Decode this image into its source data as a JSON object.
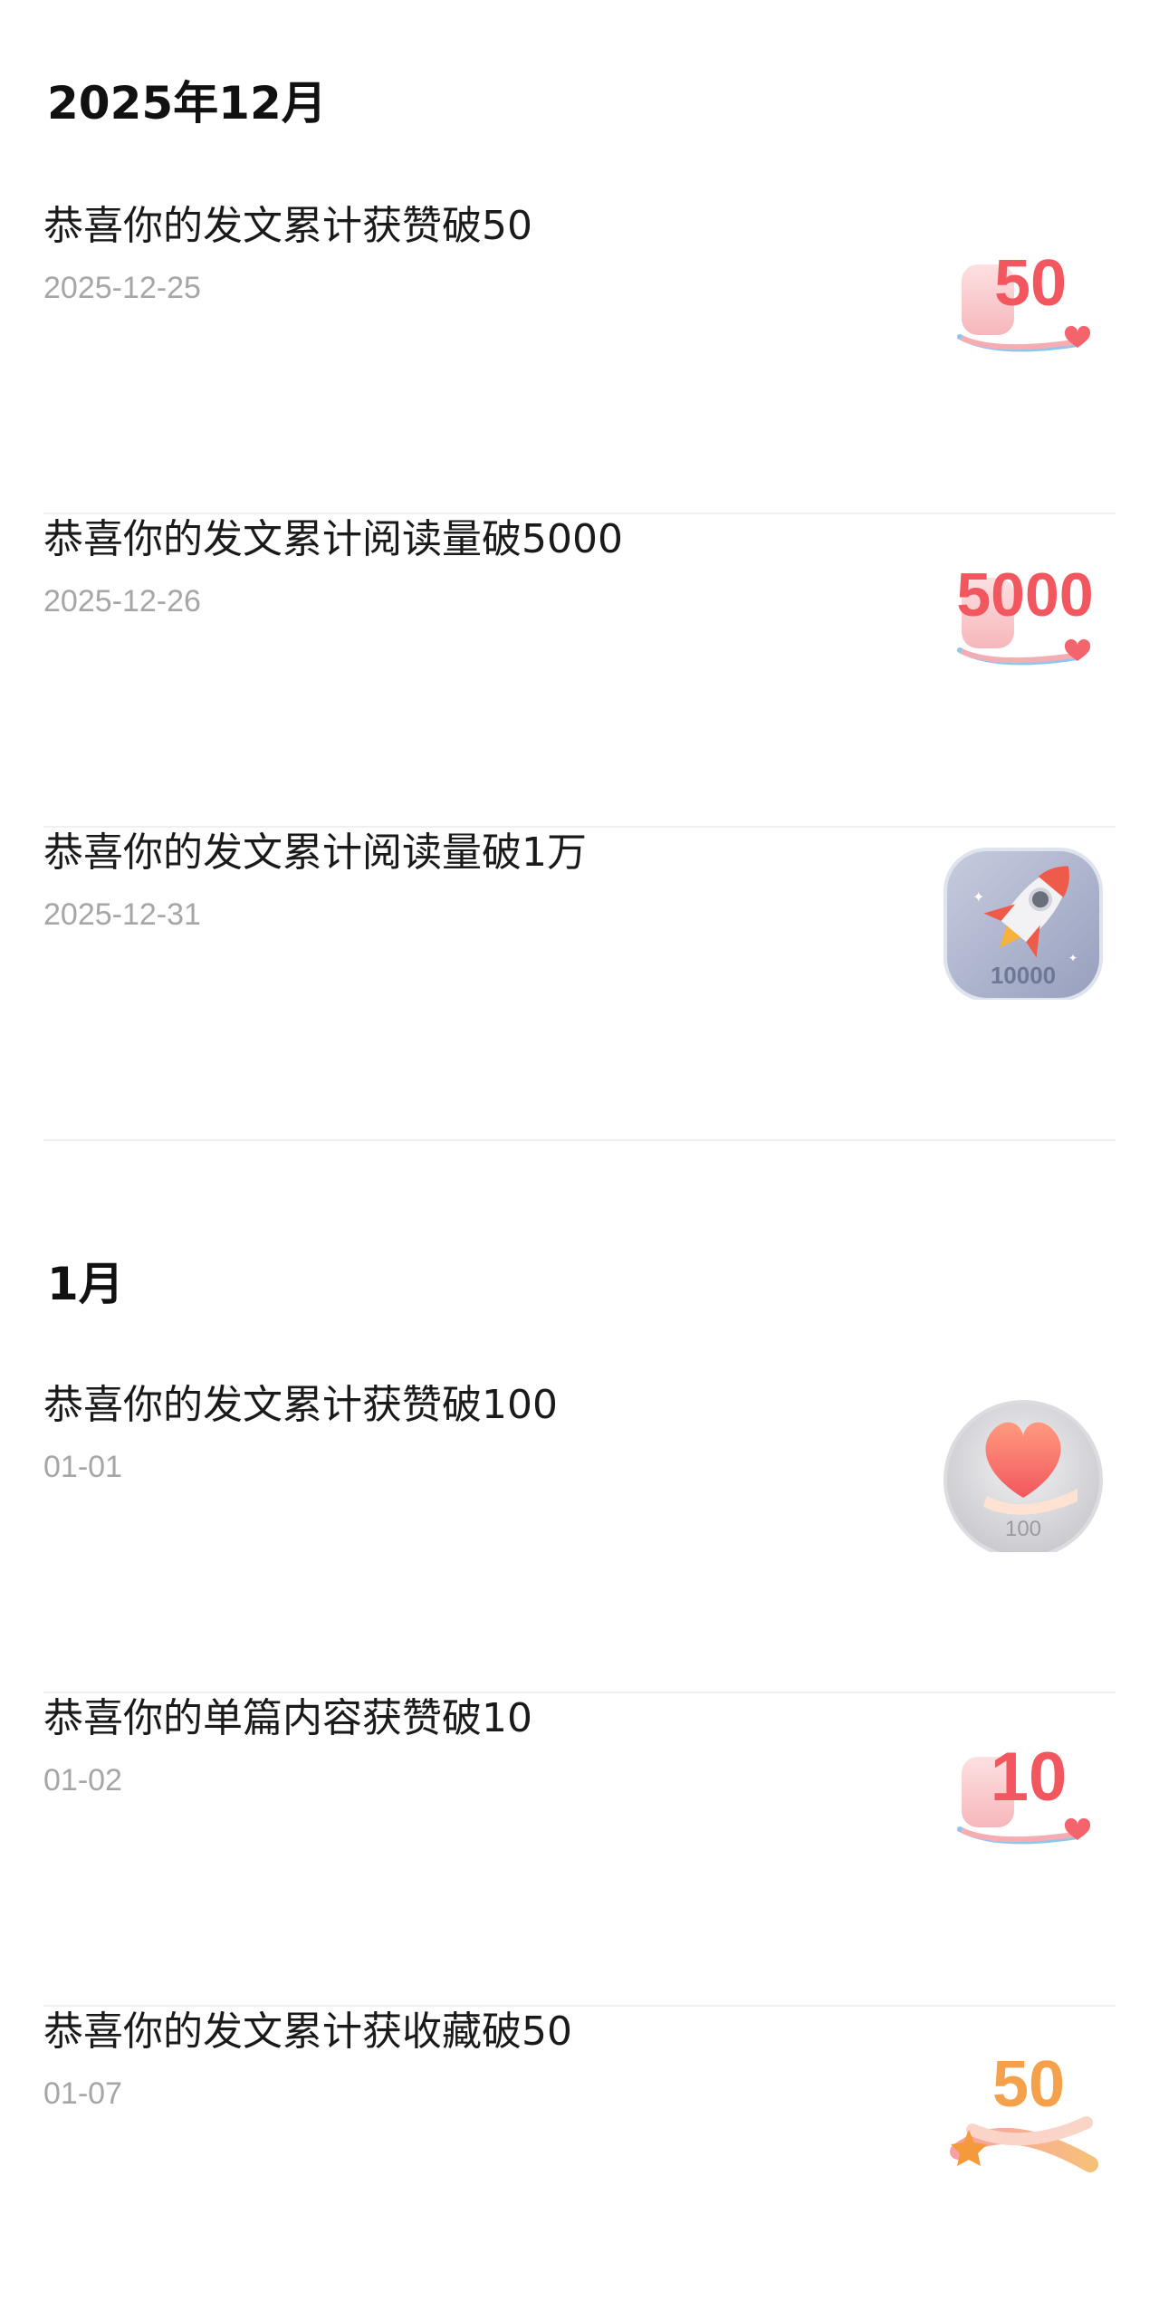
{
  "sections": [
    {
      "title": "2025年12月",
      "items": [
        {
          "title": "恭喜你的发文累计获赞破50",
          "date": "2025-12-25",
          "badge": {
            "icon": "likes-milestone-icon",
            "number": "50"
          }
        },
        {
          "title": "恭喜你的发文累计阅读量破5000",
          "date": "2025-12-26",
          "badge": {
            "icon": "reads-milestone-icon",
            "number": "5000"
          }
        },
        {
          "title": "恭喜你的发文累计阅读量破1万",
          "date": "2025-12-31",
          "badge": {
            "icon": "rocket-medal-icon",
            "number": "10000"
          }
        }
      ]
    },
    {
      "title": "1月",
      "items": [
        {
          "title": "恭喜你的发文累计获赞破100",
          "date": "01-01",
          "badge": {
            "icon": "heart-hand-medal-icon",
            "number": "100"
          }
        },
        {
          "title": "恭喜你的单篇内容获赞破10",
          "date": "01-02",
          "badge": {
            "icon": "likes-milestone-icon",
            "number": "10"
          }
        },
        {
          "title": "恭喜你的发文累计获收藏破50",
          "date": "01-07",
          "badge": {
            "icon": "favorites-milestone-icon",
            "number": "50"
          }
        }
      ]
    }
  ],
  "colors": {
    "badge_red": "#f2575f",
    "badge_pink": "#f8b4b8",
    "badge_orange": "#f5a04a",
    "divider": "#f0f0f0",
    "date_gray": "#a6a6a6"
  }
}
